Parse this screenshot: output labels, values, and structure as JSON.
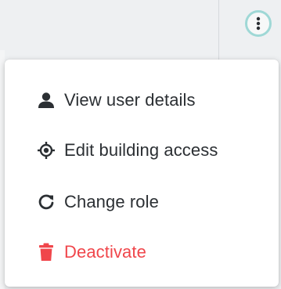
{
  "header": {
    "more_actions_icon": "kebab-vertical-icon"
  },
  "menu": {
    "items": [
      {
        "label": "View user details",
        "icon": "user-icon",
        "color": "#2b2f33"
      },
      {
        "label": "Edit building access",
        "icon": "location-target-icon",
        "color": "#2b2f33"
      },
      {
        "label": "Change role",
        "icon": "refresh-icon",
        "color": "#2b2f33"
      },
      {
        "label": "Deactivate",
        "icon": "trash-icon",
        "color": "#f0464b"
      }
    ]
  },
  "colors": {
    "danger": "#f0464b",
    "focus_ring": "#9fd8d6",
    "text": "#2b2f33"
  }
}
